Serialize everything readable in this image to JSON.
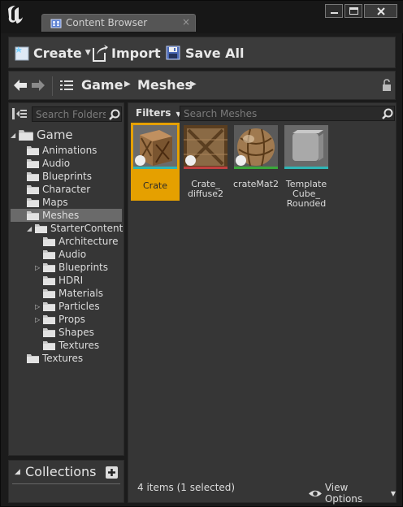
{
  "window": {
    "tab_title": "Content Browser",
    "tab_close": "×"
  },
  "toolbar": {
    "create_label": "Create",
    "import_label": "Import",
    "save_all_label": "Save All"
  },
  "path": {
    "items": [
      "Game",
      "Meshes"
    ]
  },
  "folders": {
    "search_placeholder": "Search Folders",
    "tree": [
      {
        "label": "Game",
        "level": 0,
        "expanded": true
      },
      {
        "label": "Animations",
        "level": 1
      },
      {
        "label": "Audio",
        "level": 1
      },
      {
        "label": "Blueprints",
        "level": 1
      },
      {
        "label": "Character",
        "level": 1
      },
      {
        "label": "Maps",
        "level": 1
      },
      {
        "label": "Meshes",
        "level": 1,
        "selected": true
      },
      {
        "label": "StarterContent",
        "level": 1,
        "expanded": true
      },
      {
        "label": "Architecture",
        "level": 2
      },
      {
        "label": "Audio",
        "level": 2
      },
      {
        "label": "Blueprints",
        "level": 2,
        "collapsed": true
      },
      {
        "label": "HDRI",
        "level": 2
      },
      {
        "label": "Materials",
        "level": 2
      },
      {
        "label": "Particles",
        "level": 2,
        "collapsed": true
      },
      {
        "label": "Props",
        "level": 2,
        "collapsed": true
      },
      {
        "label": "Shapes",
        "level": 2
      },
      {
        "label": "Textures",
        "level": 2
      },
      {
        "label": "Textures",
        "level": 1
      }
    ]
  },
  "collections": {
    "label": "Collections"
  },
  "assets": {
    "filters_label": "Filters",
    "search_placeholder": "Search Meshes",
    "items": [
      {
        "label": "Crate",
        "selected": true,
        "color": "#2fb5b5"
      },
      {
        "label": "Crate_ diffuse2",
        "color": "#c04040"
      },
      {
        "label": "crateMat2",
        "color": "#3aa83a"
      },
      {
        "label": "Template Cube_ Rounded",
        "color": "#2fb5b5"
      }
    ],
    "status_text": "4 items (1 selected)",
    "view_options_label": "View Options"
  }
}
